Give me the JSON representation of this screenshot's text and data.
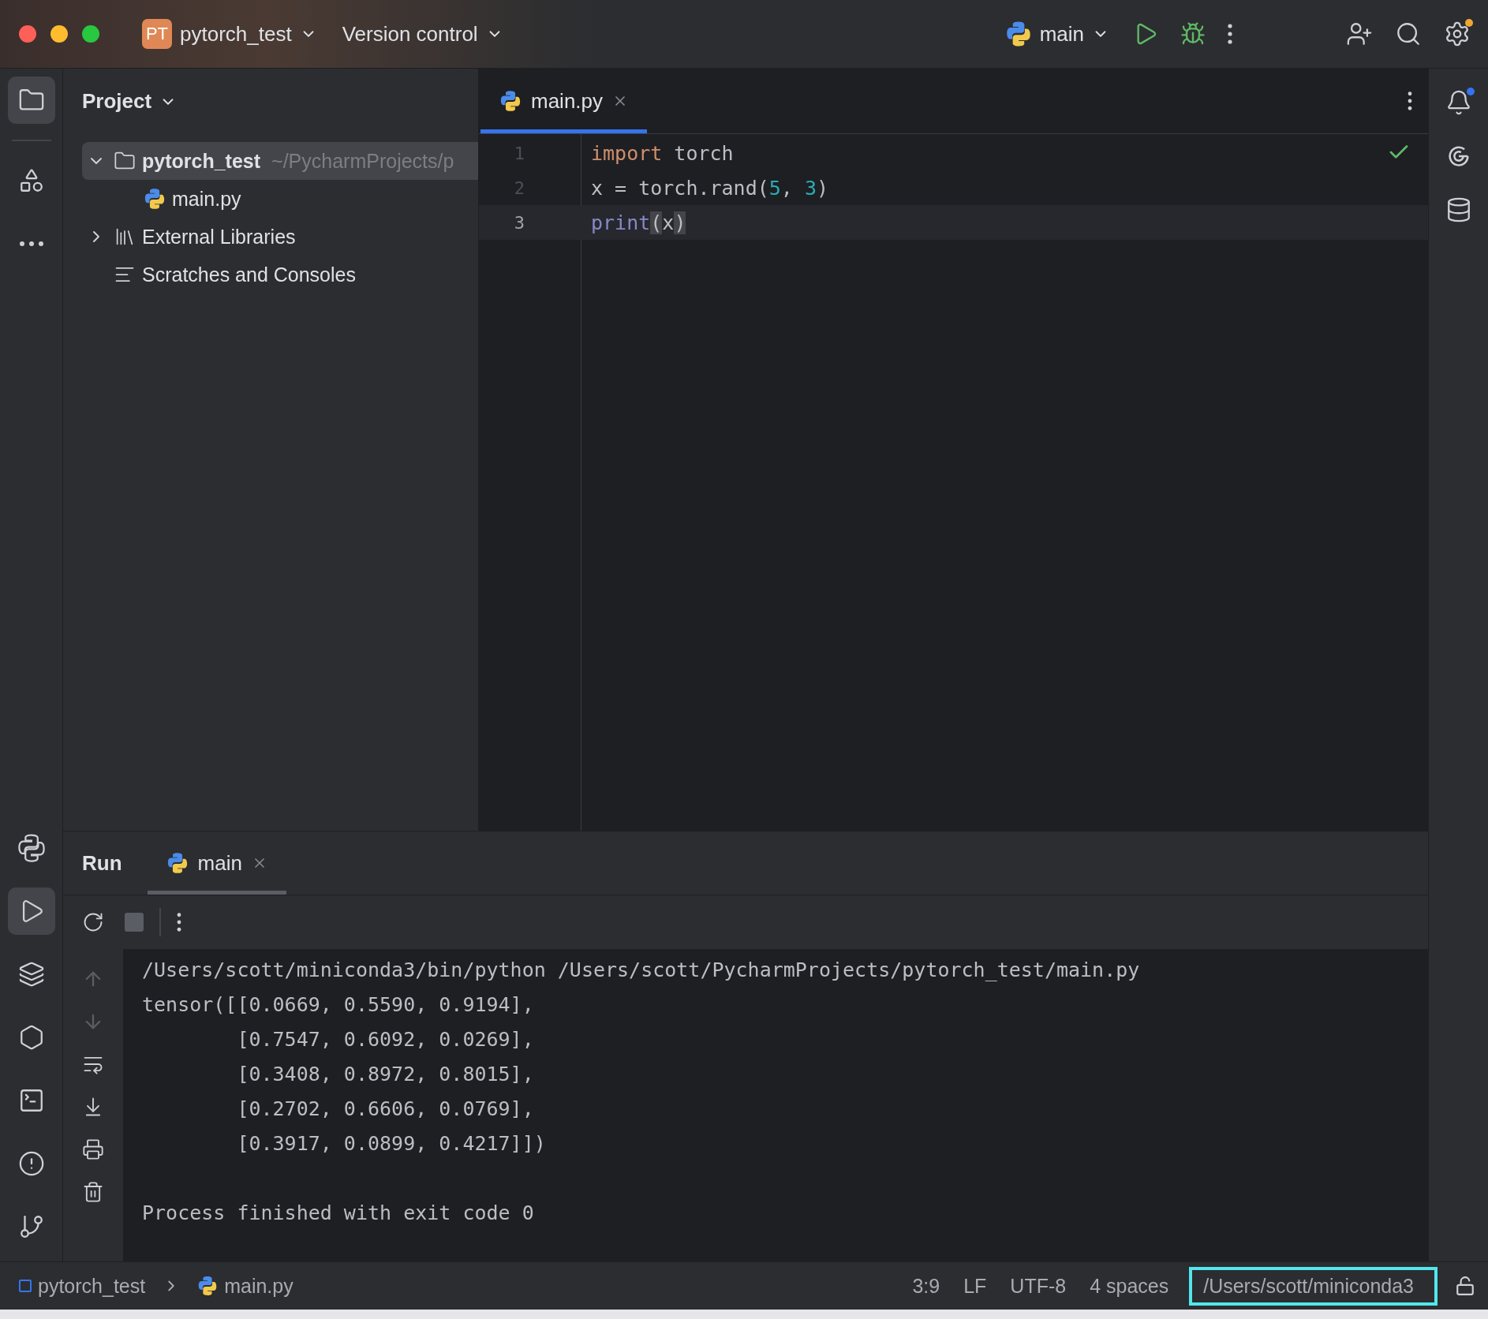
{
  "title_bar": {
    "project_badge": "PT",
    "project": "pytorch_test",
    "vcs": "Version control",
    "run_config": "main"
  },
  "left_toolbar_top": [
    {
      "kind": "project",
      "selected": true
    },
    {
      "kind": "structure",
      "selected": false
    },
    {
      "kind": "more",
      "selected": false
    }
  ],
  "left_toolbar_bottom": [
    {
      "kind": "python-console",
      "selected": false
    },
    {
      "kind": "run",
      "selected": true
    },
    {
      "kind": "layers",
      "selected": false
    },
    {
      "kind": "services",
      "selected": false
    },
    {
      "kind": "terminal",
      "selected": false
    },
    {
      "kind": "problems",
      "selected": false
    },
    {
      "kind": "git",
      "selected": false
    }
  ],
  "project_panel": {
    "title": "Project",
    "tree": [
      {
        "kind": "folder",
        "name": "pytorch_test",
        "path": "~/PycharmProjects/p",
        "expanded": true,
        "selected": true,
        "children": [
          {
            "kind": "python",
            "name": "main.py",
            "selected": false
          }
        ]
      },
      {
        "kind": "library",
        "name": "External Libraries",
        "expanded": false,
        "selected": false
      },
      {
        "kind": "scratches",
        "name": "Scratches and Consoles",
        "selected": false
      }
    ]
  },
  "editor": {
    "tabs": [
      {
        "label": "main.py",
        "selected": true
      }
    ],
    "lines": [
      {
        "number": "1",
        "current": false,
        "tokens": [
          {
            "kind": "keyword",
            "text": "import"
          },
          {
            "kind": "plain",
            "text": " torch"
          }
        ]
      },
      {
        "number": "2",
        "current": false,
        "tokens": [
          {
            "kind": "plain",
            "text": "x = torch.rand("
          },
          {
            "kind": "number",
            "text": "5"
          },
          {
            "kind": "plain",
            "text": ", "
          },
          {
            "kind": "number",
            "text": "3"
          },
          {
            "kind": "plain",
            "text": ")"
          }
        ]
      },
      {
        "number": "3",
        "current": true,
        "tokens": [
          {
            "kind": "builtin",
            "text": "print"
          },
          {
            "kind": "brace",
            "text": "("
          },
          {
            "kind": "plain",
            "text": "x"
          },
          {
            "kind": "brace",
            "text": ")"
          }
        ]
      }
    ]
  },
  "run_panel": {
    "title": "Run",
    "tabs": [
      {
        "label": "main",
        "selected": true
      }
    ],
    "output_blocks": [
      [
        "/Users/scott/miniconda3/bin/python /Users/scott/PycharmProjects/pytorch_test/main.py",
        "tensor([[0.0669, 0.5590, 0.9194],",
        "        [0.7547, 0.6092, 0.0269],",
        "        [0.3408, 0.8972, 0.8015],",
        "        [0.2702, 0.6606, 0.0769],",
        "        [0.3917, 0.0899, 0.4217]])"
      ],
      [
        "Process finished with exit code 0"
      ]
    ]
  },
  "status_bar": {
    "breadcrumbs": [
      "pytorch_test",
      "main.py"
    ],
    "items": [
      "3:9",
      "LF",
      "UTF-8",
      "4 spaces"
    ],
    "interpreter": {
      "text": "/Users/scott/miniconda3",
      "highlighted": true
    }
  }
}
